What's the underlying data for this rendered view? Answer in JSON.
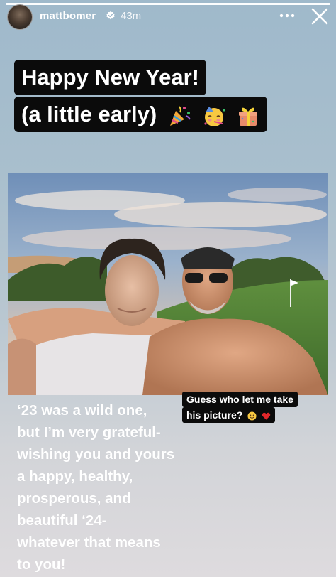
{
  "story": {
    "progress_fraction": 1.0,
    "header": {
      "username": "mattbomer",
      "time": "43m",
      "icons": [
        "verified-badge-icon",
        "more-options-icon",
        "close-icon"
      ]
    },
    "caption": {
      "line1": "Happy New Year!",
      "line2": "(a little early)",
      "emojis": [
        "party-popper",
        "partying-face",
        "wrapped-gift"
      ]
    },
    "photo_sticker": {
      "line1": "Guess who let me take",
      "line2": "his picture?",
      "emojis": [
        "smiling-face",
        "red-heart"
      ]
    },
    "body": "‘23 was  a wild one,\nbut I’m very grateful-\nwishing you and yours\na happy, healthy,\nprosperous, and\nbeautiful ‘24-\nwhatever that means\nto you!"
  },
  "colors": {
    "caption_bg": "#0b0b0b",
    "text": "#ffffff",
    "verified": "#ffffff",
    "heart": "#e0262a"
  }
}
